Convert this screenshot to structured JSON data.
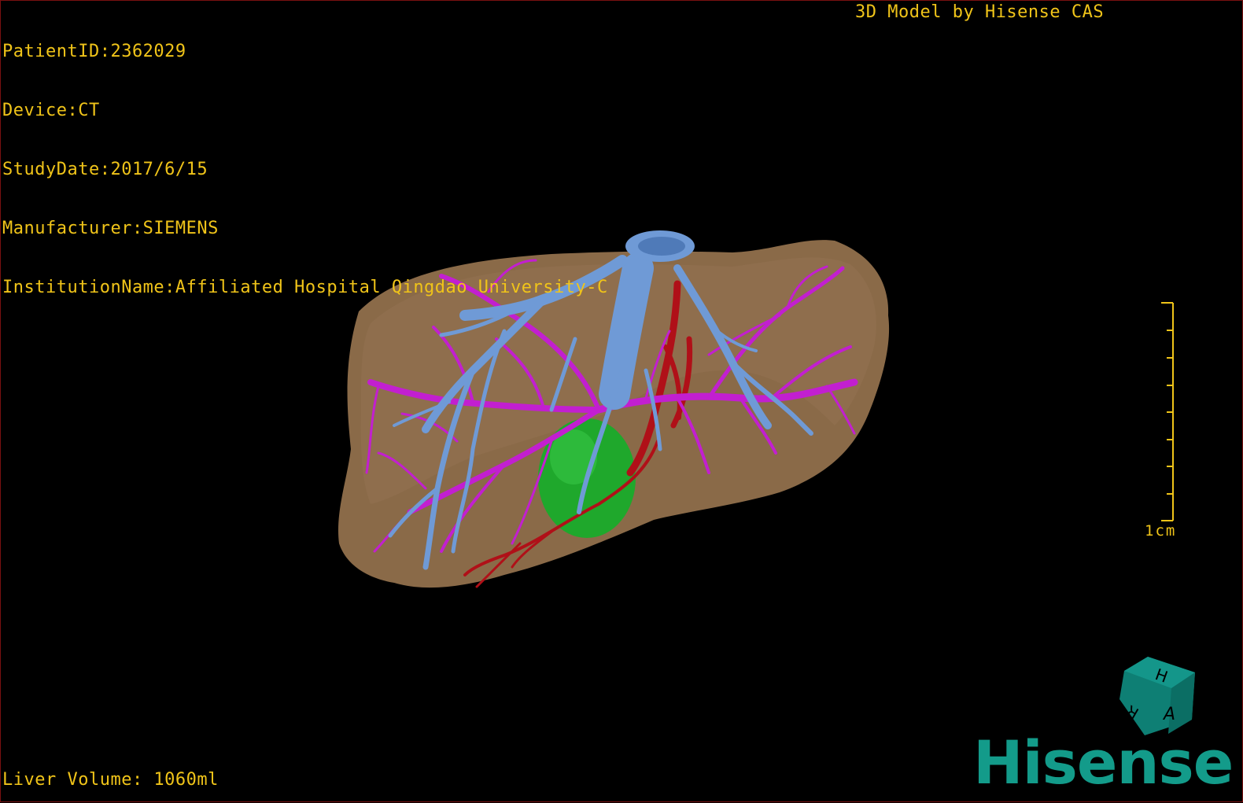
{
  "meta": {
    "patient_id": "PatientID:2362029",
    "device": "Device:CT",
    "study_date": "StudyDate:2017/6/15",
    "manufacturer": "Manufacturer:SIEMENS",
    "institution": "InstitutionName:Affiliated Hospital Qingdao University-C"
  },
  "app_title": "3D Model by Hisense CAS",
  "liver_volume": "Liver Volume: 1060ml",
  "scale_bar": {
    "label": "1cm"
  },
  "orientation_cube": {
    "icon": "orientation-cube-icon",
    "faces": [
      "H",
      "A",
      "R"
    ],
    "color": "#0e7f74"
  },
  "logo": {
    "text": "Hisense",
    "color": "#139b8a"
  },
  "colors": {
    "overlay_text": "#f0c419",
    "liver": "#8a6a48",
    "hepatic_vein": "#6f9ad6",
    "portal_vein": "#c21fd0",
    "artery": "#b01018",
    "tumor": "#1fa82c"
  }
}
